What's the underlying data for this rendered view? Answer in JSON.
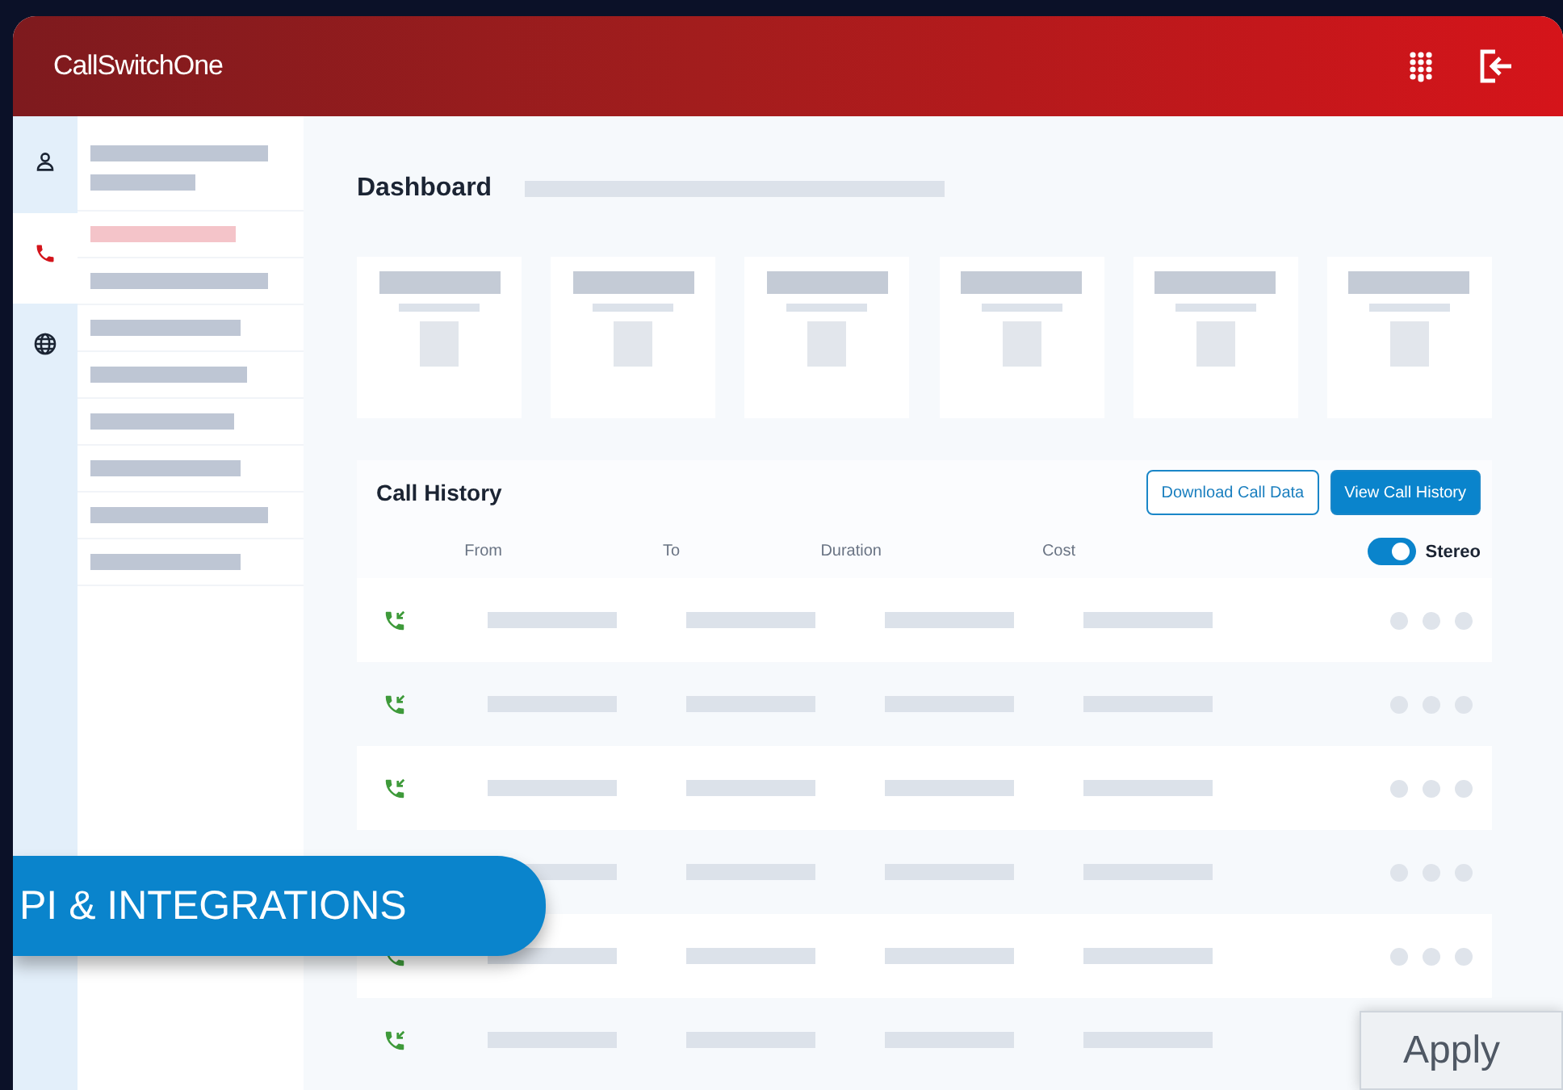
{
  "header": {
    "brand": "CallSwitchOne"
  },
  "rail": [
    {
      "kind": "user",
      "selected": false
    },
    {
      "kind": "phone",
      "selected": true
    },
    {
      "kind": "globe",
      "selected": false
    }
  ],
  "page": {
    "title": "Dashboard"
  },
  "call_history": {
    "title": "Call History",
    "buttons": [
      {
        "label": "Download Call Data",
        "kind": "outline"
      },
      {
        "label": "View Call History",
        "kind": "primary"
      }
    ],
    "columns": [
      "From",
      "To",
      "Duration",
      "Cost"
    ],
    "stereo": {
      "label": "Stereo",
      "on": true
    }
  },
  "banner": {
    "label": "PI & INTEGRATIONS"
  },
  "apply_button": {
    "label": "Apply"
  }
}
